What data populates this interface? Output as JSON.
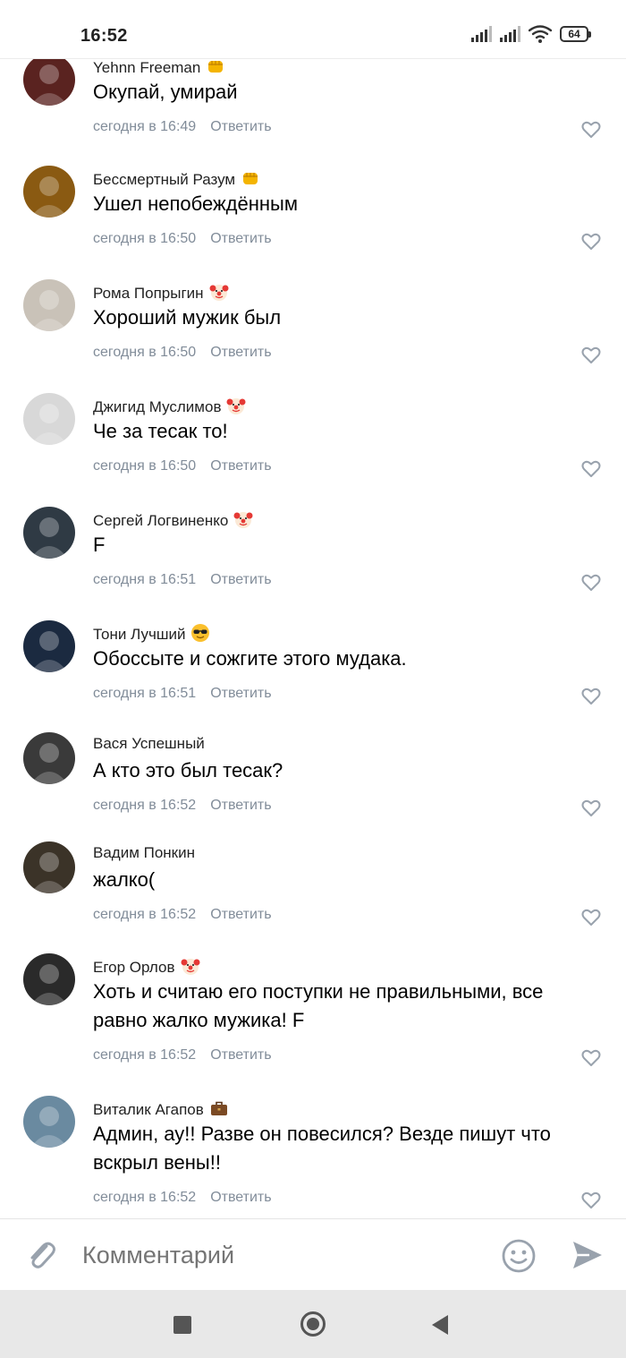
{
  "status_bar": {
    "time": "16:52",
    "battery": "64"
  },
  "comments": [
    {
      "author": "Yehnn Freeman",
      "badge": "fist-emoji",
      "text": "Окупай, умирай",
      "time": "сегодня в 16:49",
      "reply": "Ответить",
      "avatar_color": "#5a2320"
    },
    {
      "author": "Бессмертный Разум",
      "badge": "fist-emoji",
      "text": "Ушел непобеждённым",
      "time": "сегодня в 16:50",
      "reply": "Ответить",
      "avatar_color": "#8a5a12"
    },
    {
      "author": "Рома Попрыгин",
      "badge": "clown-emoji",
      "text": "Хороший мужик был",
      "time": "сегодня в 16:50",
      "reply": "Ответить",
      "avatar_color": "#c9c2b8"
    },
    {
      "author": "Джигид Муслимов",
      "badge": "clown-emoji",
      "text": "Че за тесак то!",
      "time": "сегодня в 16:50",
      "reply": "Ответить",
      "avatar_color": "#d8d8d8"
    },
    {
      "author": "Сергей Логвиненко",
      "badge": "clown-emoji",
      "text": "F",
      "time": "сегодня в 16:51",
      "reply": "Ответить",
      "avatar_color": "#2f3a44"
    },
    {
      "author": "Тони Лучший",
      "badge": "sunglasses-emoji",
      "text": "Обоссыте и сожгите этого мудака.",
      "time": "сегодня в 16:51",
      "reply": "Ответить",
      "avatar_color": "#1b2a40"
    },
    {
      "author": "Вася Успешный",
      "badge": "",
      "text": "А кто это был тесак?",
      "time": "сегодня в 16:52",
      "reply": "Ответить",
      "avatar_color": "#3a3a3a"
    },
    {
      "author": "Вадим Понкин",
      "badge": "",
      "text": "жалко(",
      "time": "сегодня в 16:52",
      "reply": "Ответить",
      "avatar_color": "#3b3328"
    },
    {
      "author": "Егор Орлов",
      "badge": "clown-emoji",
      "text": "Хоть и считаю его поступки не правильными, все равно жалко мужика! F",
      "time": "сегодня в 16:52",
      "reply": "Ответить",
      "avatar_color": "#2a2a2a"
    },
    {
      "author": "Виталик Агапов",
      "badge": "briefcase-emoji",
      "text": "Админ, ау!! Разве он повесился? Везде пишут что вскрыл вены!!",
      "time": "сегодня в 16:52",
      "reply": "Ответить",
      "avatar_color": "#6a8aa0"
    }
  ],
  "composer": {
    "placeholder": "Комментарий"
  },
  "icons": {
    "like": "heart-outline-icon",
    "attach": "paperclip-icon",
    "emoji": "smiley-icon",
    "send": "send-arrow-icon"
  },
  "colors": {
    "meta": "#818c99",
    "icon": "#99a2ad",
    "accent": "#2688eb"
  }
}
